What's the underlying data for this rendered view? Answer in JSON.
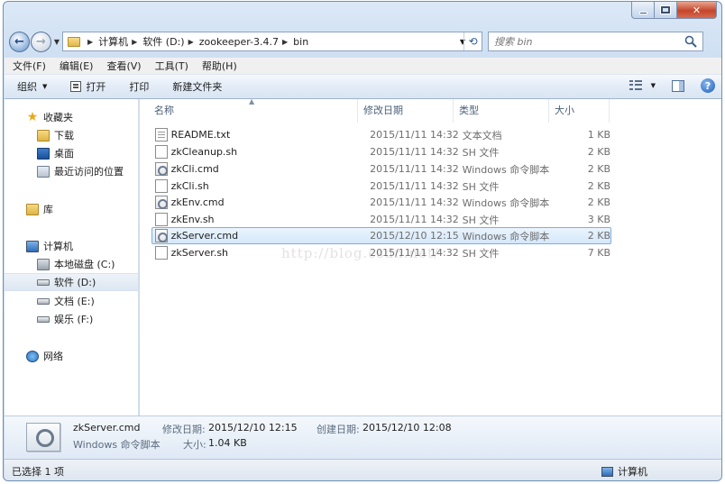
{
  "window": {
    "caption_close": "✕"
  },
  "address": {
    "crumbs": [
      "计算机",
      "软件 (D:)",
      "zookeeper-3.4.7",
      "bin"
    ]
  },
  "search": {
    "placeholder": "搜索 bin"
  },
  "menu": [
    "文件(F)",
    "编辑(E)",
    "查看(V)",
    "工具(T)",
    "帮助(H)"
  ],
  "toolbar": {
    "organize": "组织",
    "open": "打开",
    "print": "打印",
    "new_folder": "新建文件夹",
    "help": "?"
  },
  "nav": {
    "favorites": "收藏夹",
    "downloads": "下载",
    "desktop": "桌面",
    "recent": "最近访问的位置",
    "libraries": "库",
    "computer": "计算机",
    "drive_c": "本地磁盘 (C:)",
    "drive_d": "软件 (D:)",
    "drive_e": "文档 (E:)",
    "drive_f": "娱乐 (F:)",
    "network": "网络"
  },
  "columns": {
    "name": "名称",
    "date": "修改日期",
    "type": "类型",
    "size": "大小"
  },
  "files": [
    {
      "name": "README.txt",
      "date": "2015/11/11 14:32",
      "type": "文本文档",
      "size": "1 KB",
      "icon": "text-file-icon"
    },
    {
      "name": "zkCleanup.sh",
      "date": "2015/11/11 14:32",
      "type": "SH 文件",
      "size": "2 KB",
      "icon": "file-icon"
    },
    {
      "name": "zkCli.cmd",
      "date": "2015/11/11 14:32",
      "type": "Windows 命令脚本",
      "size": "2 KB",
      "icon": "cmd-script-icon"
    },
    {
      "name": "zkCli.sh",
      "date": "2015/11/11 14:32",
      "type": "SH 文件",
      "size": "2 KB",
      "icon": "file-icon"
    },
    {
      "name": "zkEnv.cmd",
      "date": "2015/11/11 14:32",
      "type": "Windows 命令脚本",
      "size": "2 KB",
      "icon": "cmd-script-icon"
    },
    {
      "name": "zkEnv.sh",
      "date": "2015/11/11 14:32",
      "type": "SH 文件",
      "size": "3 KB",
      "icon": "file-icon"
    },
    {
      "name": "zkServer.cmd",
      "date": "2015/12/10 12:15",
      "type": "Windows 命令脚本",
      "size": "2 KB",
      "icon": "cmd-script-icon",
      "selected": true
    },
    {
      "name": "zkServer.sh",
      "date": "2015/11/11 14:32",
      "type": "SH 文件",
      "size": "7 KB",
      "icon": "file-icon"
    }
  ],
  "watermark": "http://blog.csdn.net/",
  "details": {
    "name": "zkServer.cmd",
    "type": "Windows 命令脚本",
    "modified_label": "修改日期:",
    "modified": "2015/12/10 12:15",
    "created_label": "创建日期:",
    "created": "2015/12/10 12:08",
    "size_label": "大小:",
    "size": "1.04 KB"
  },
  "status": {
    "selection": "已选择 1 项",
    "location": "计算机"
  },
  "colors": {
    "selection_bg": "#d4e8fb",
    "selection_border": "#84acdd",
    "chrome": "#cfe0f3"
  }
}
